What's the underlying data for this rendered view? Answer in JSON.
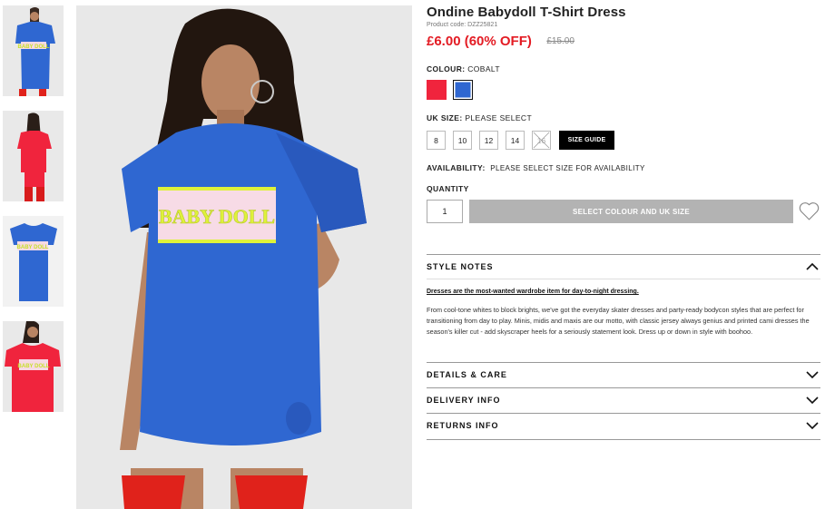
{
  "product": {
    "title": "Ondine Babydoll T-Shirt Dress",
    "product_code": "Product code: DZZ25821",
    "price": "£6.00 (60% OFF)",
    "was_price": "£15.00",
    "print_text": "BABY DOLL"
  },
  "colour": {
    "label": "COLOUR:",
    "selected": "COBALT",
    "swatches": [
      {
        "name": "Red",
        "color": "#f0243d"
      },
      {
        "name": "Cobalt",
        "color": "#2f67d1"
      }
    ]
  },
  "size": {
    "label": "UK SIZE:",
    "selected": "PLEASE SELECT",
    "options": [
      "8",
      "10",
      "12",
      "14",
      "16"
    ],
    "guide_label": "SIZE GUIDE"
  },
  "availability": {
    "label": "AVAILABILITY:",
    "value": "PLEASE SELECT SIZE FOR AVAILABILITY"
  },
  "quantity": {
    "label": "QUANTITY",
    "value": "1"
  },
  "cart_button": "SELECT COLOUR AND UK SIZE",
  "accordion": {
    "style_notes": "STYLE NOTES",
    "details_care": "DETAILS & CARE",
    "delivery_info": "DELIVERY INFO",
    "returns_info": "RETURNS INFO"
  },
  "style_notes": {
    "headline": "Dresses are the most-wanted wardrobe item for day-to-night dressing.",
    "body": "From cool-tone whites to block brights, we've got the everyday skater dresses and party-ready bodycon styles that are perfect for transitioning from day to play. Minis, midis and maxis are our motto, with classic jersey always genius and printed cami dresses the season's killer cut - add skyscraper heels for a seriously statement look. Dress up or down in style with boohoo."
  },
  "icons": {
    "wishlist": "heart-icon",
    "expanded": "chevron-up-icon",
    "collapsed": "chevron-down-icon",
    "unavailable": "cross-icon"
  },
  "colors": {
    "price_red": "#e31b23",
    "button_grey": "#b3b3b3",
    "dress_blue": "#2f67d1",
    "dress_red": "#f0243d",
    "print_yellow": "#dff23a"
  }
}
